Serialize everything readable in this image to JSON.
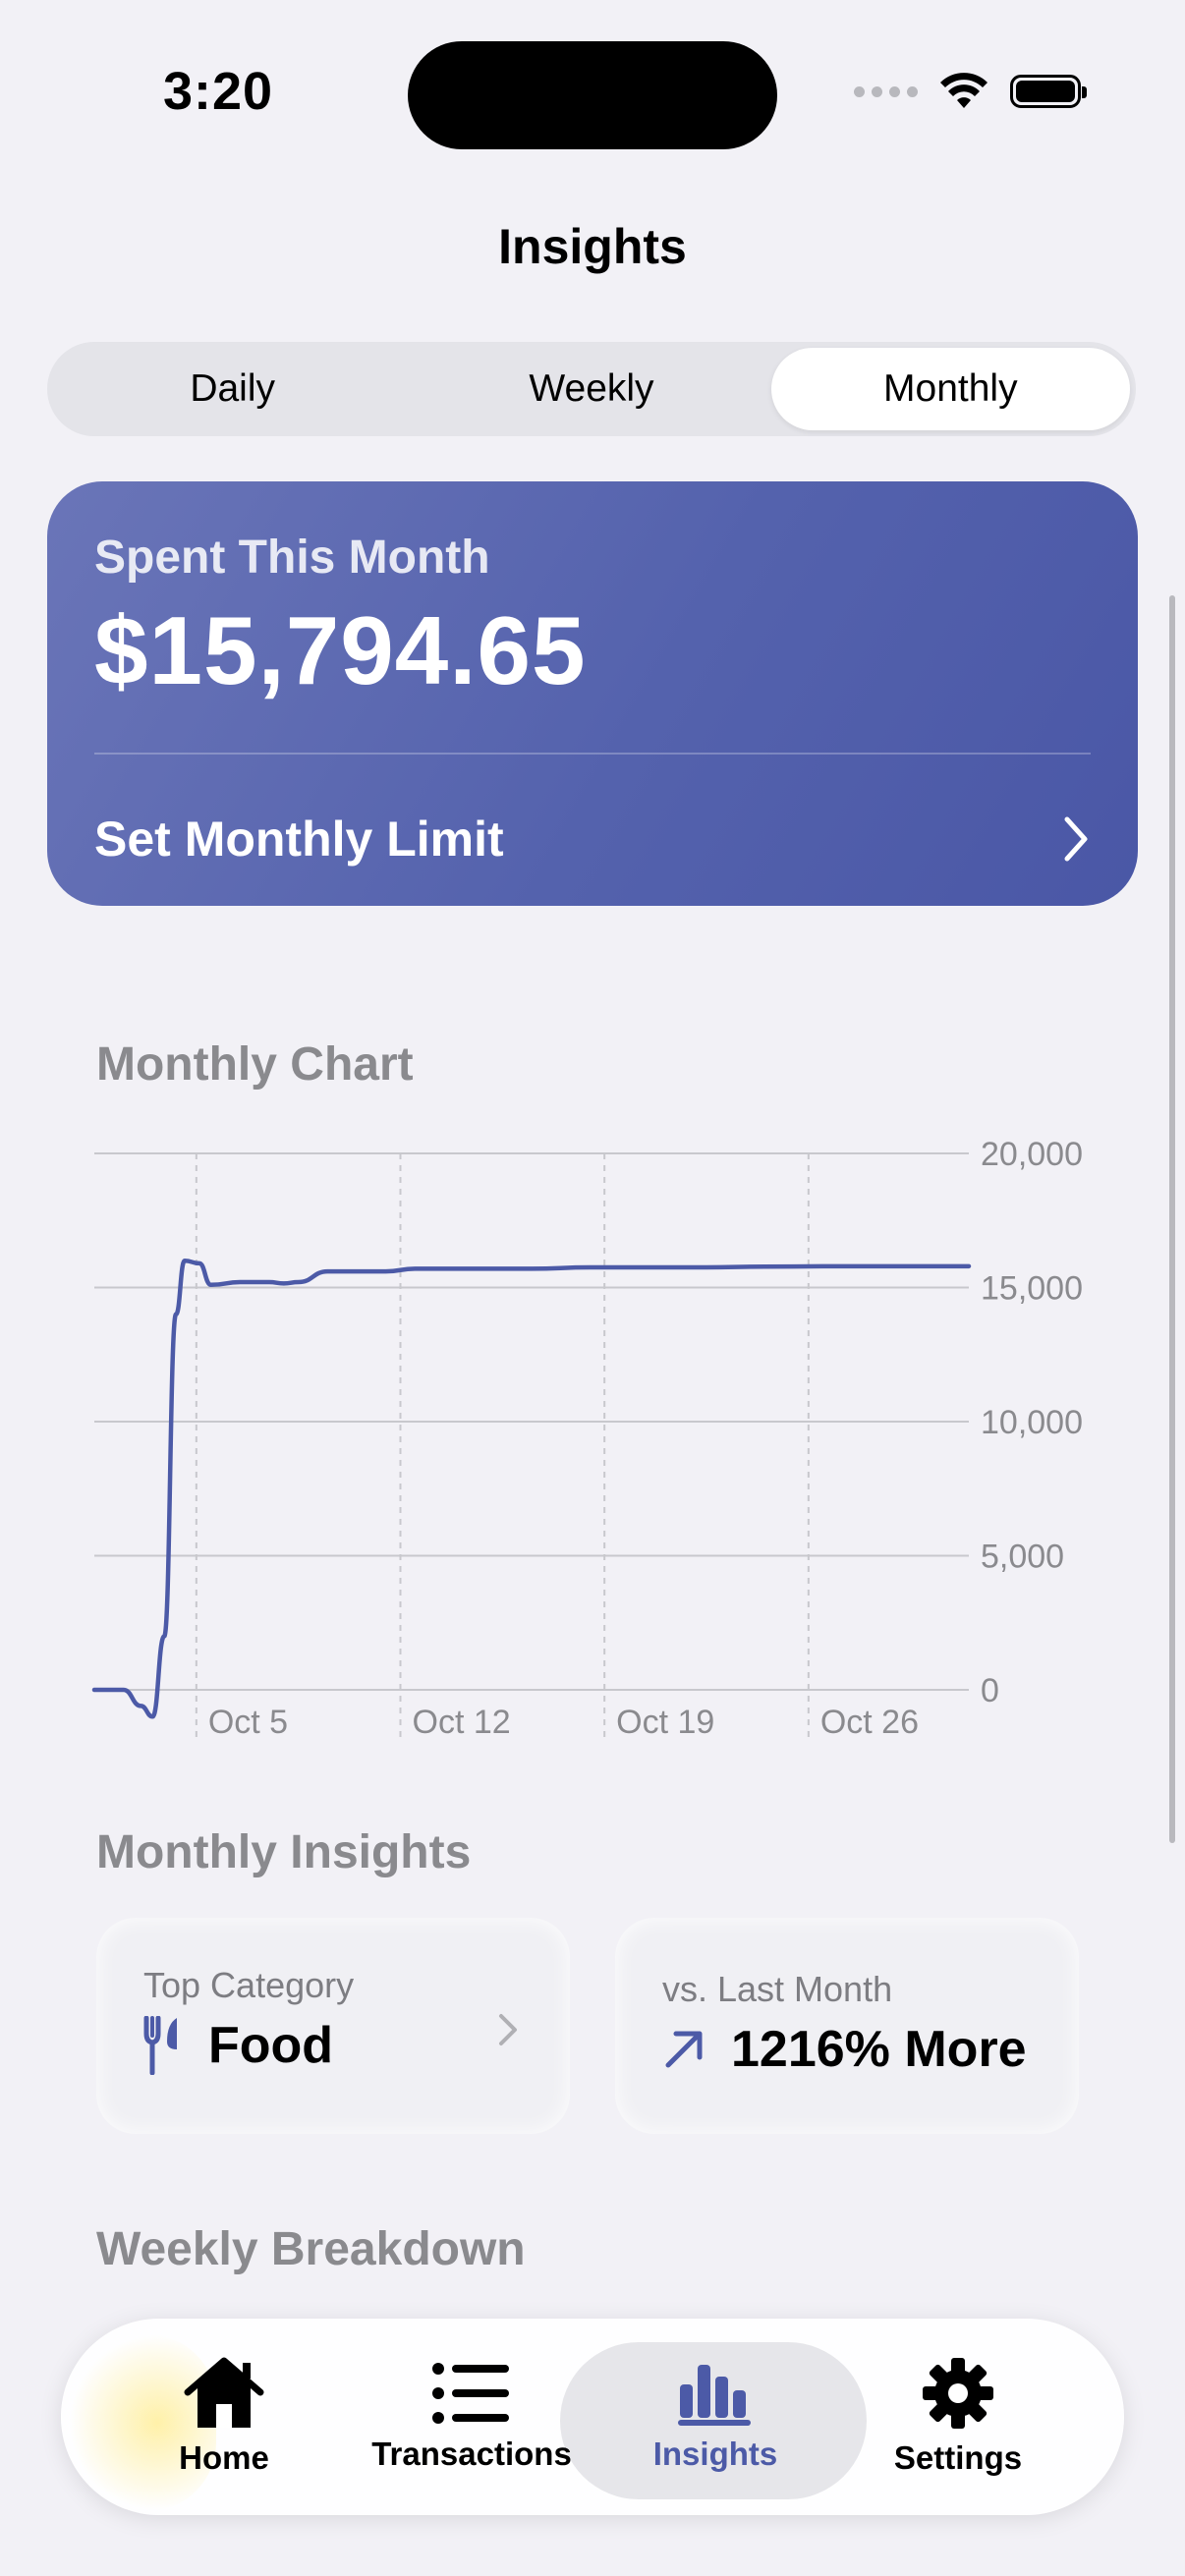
{
  "status_bar": {
    "time": "3:20"
  },
  "nav": {
    "title": "Insights"
  },
  "segments": [
    {
      "label": "Daily",
      "active": false
    },
    {
      "label": "Weekly",
      "active": false
    },
    {
      "label": "Monthly",
      "active": true
    }
  ],
  "spent_card": {
    "label": "Spent This Month",
    "amount": "$15,794.65",
    "limit_label": "Set Monthly Limit"
  },
  "chart_section": {
    "title": "Monthly Chart"
  },
  "chart_data": {
    "type": "line",
    "x_ticks": [
      "Oct 5",
      "Oct 12",
      "Oct 19",
      "Oct 26"
    ],
    "y_ticks": [
      "0",
      "5,000",
      "10,000",
      "15,000",
      "20,000"
    ],
    "ylim": [
      0,
      20000
    ],
    "xlim_days": [
      1,
      31
    ],
    "grid": true,
    "color": "#4c5aa7",
    "series": [
      {
        "x": [
          1,
          2,
          2.6,
          3,
          3.4,
          3.8,
          4.1,
          4.6,
          5,
          6,
          7,
          7.5,
          8,
          9,
          10,
          11,
          12,
          14,
          16,
          18,
          20,
          22,
          24,
          26,
          28,
          31
        ],
        "y": [
          0,
          0,
          -600,
          -1000,
          2000,
          14000,
          16000,
          15900,
          15100,
          15200,
          15200,
          15150,
          15200,
          15600,
          15600,
          15600,
          15700,
          15700,
          15700,
          15750,
          15750,
          15750,
          15780,
          15790,
          15794,
          15794
        ]
      }
    ]
  },
  "insights_section": {
    "title": "Monthly Insights",
    "top_category": {
      "label": "Top Category",
      "value": "Food"
    },
    "vs_last_month": {
      "label": "vs. Last Month",
      "value": "1216% More"
    }
  },
  "weekly_section": {
    "title": "Weekly Breakdown"
  },
  "tabbar": {
    "items": [
      {
        "label": "Home",
        "icon": "house-icon"
      },
      {
        "label": "Transactions",
        "icon": "list-icon"
      },
      {
        "label": "Insights",
        "icon": "chart-bar-icon",
        "active": true
      },
      {
        "label": "Settings",
        "icon": "gear-icon"
      }
    ]
  }
}
